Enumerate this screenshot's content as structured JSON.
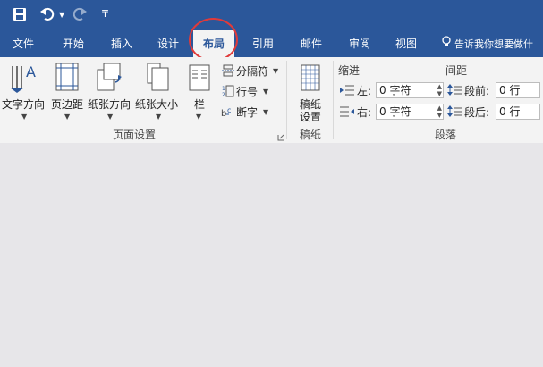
{
  "qat": {
    "dropdown_glyph": "₸"
  },
  "tabs": [
    {
      "label": "文件"
    },
    {
      "label": "开始"
    },
    {
      "label": "插入"
    },
    {
      "label": "设计"
    },
    {
      "label": "布局"
    },
    {
      "label": "引用"
    },
    {
      "label": "邮件"
    },
    {
      "label": "审阅"
    },
    {
      "label": "视图"
    }
  ],
  "tell_me": "告诉我你想要做什",
  "page_setup": {
    "text_direction": "文字方向",
    "margins": "页边距",
    "orientation": "纸张方向",
    "size": "纸张大小",
    "columns": "栏",
    "breaks": "分隔符",
    "line_numbers": "行号",
    "hyphenation": "断字",
    "group_label": "页面设置"
  },
  "draft": {
    "button_line1": "稿纸",
    "button_line2": "设置",
    "group_label": "稿纸"
  },
  "paragraph": {
    "indent_title": "缩进",
    "spacing_title": "间距",
    "left_label": "左:",
    "right_label": "右:",
    "before_label": "段前:",
    "after_label": "段后:",
    "left_value": "0 字符",
    "right_value": "0 字符",
    "before_value": "0 行",
    "after_value": "0 行",
    "group_label": "段落"
  },
  "colors": {
    "accent": "#2b579a",
    "highlight": "#e03a3a"
  }
}
